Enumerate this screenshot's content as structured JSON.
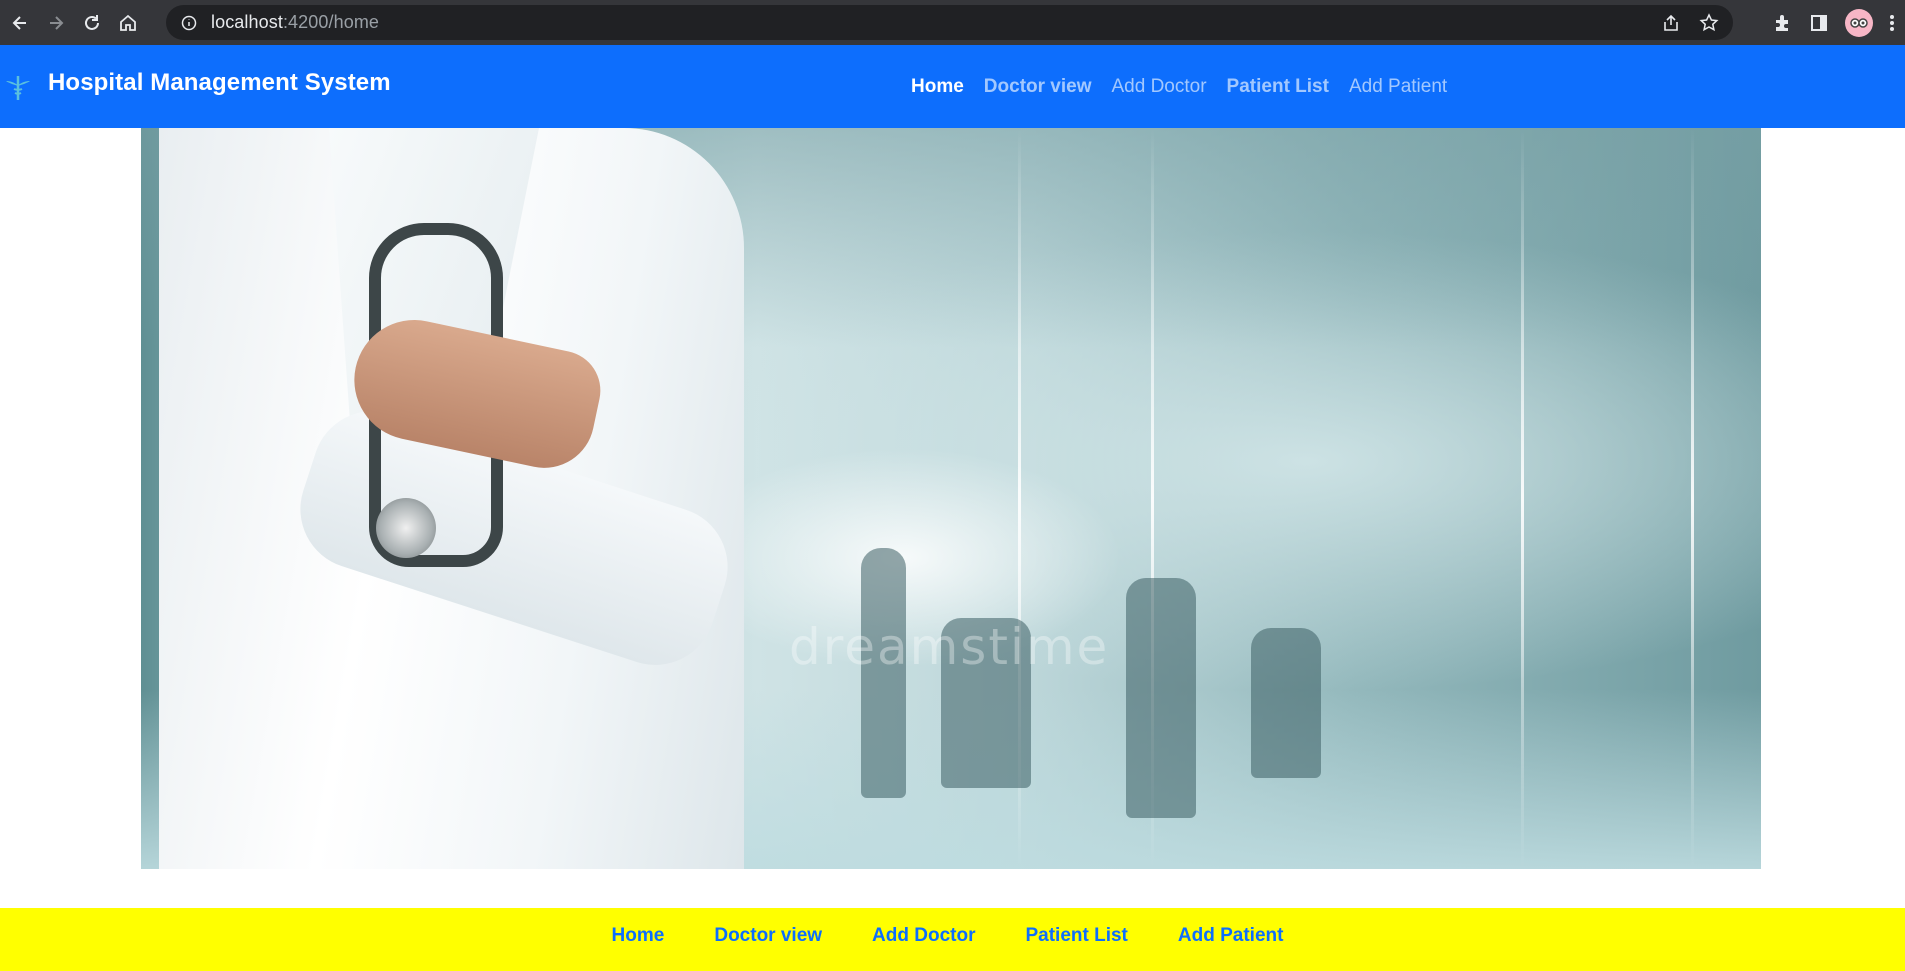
{
  "browser": {
    "url_host": "localhost",
    "url_rest": ":4200/home",
    "icons": [
      "back-arrow-icon",
      "forward-arrow-icon",
      "reload-icon",
      "home-icon",
      "site-info-icon",
      "share-icon",
      "bookmark-star-icon",
      "extensions-puzzle-icon",
      "side-panel-icon",
      "profile-avatar-icon",
      "kebab-menu-icon"
    ]
  },
  "navbar": {
    "brand_title": "Hospital Management System",
    "brand_icon": "caduceus-icon",
    "links": [
      {
        "label": "Home",
        "state": "active"
      },
      {
        "label": "Doctor view",
        "state": "bold"
      },
      {
        "label": "Add Doctor",
        "state": "plain"
      },
      {
        "label": "Patient List",
        "state": "bold"
      },
      {
        "label": "Add Patient",
        "state": "plain"
      }
    ]
  },
  "hero": {
    "watermark": "dreamstime"
  },
  "footer": {
    "links": [
      "Home",
      "Doctor view",
      "Add Doctor",
      "Patient List",
      "Add Patient"
    ]
  },
  "colors": {
    "navbar_bg": "#0d6efd",
    "footer_bg": "#ffff00",
    "footer_link": "#0d6efd",
    "chrome_bg": "#35363a",
    "omnibox_bg": "#202124"
  }
}
